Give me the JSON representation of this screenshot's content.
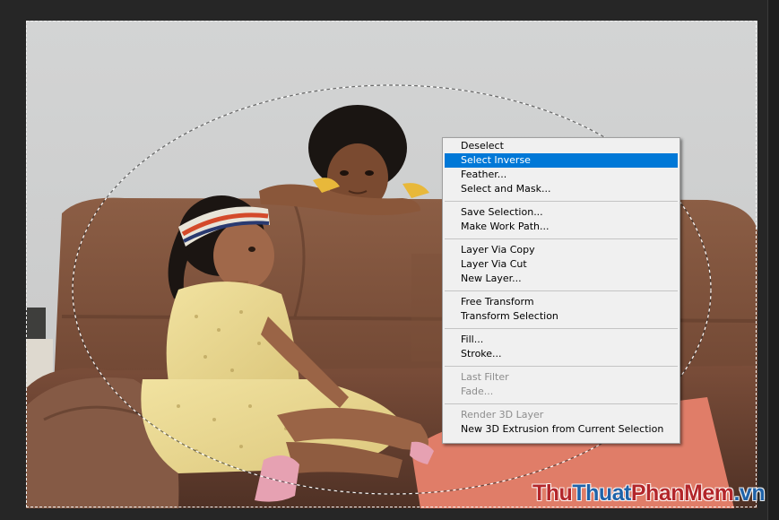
{
  "context_menu": {
    "groups": [
      [
        {
          "label": "Deselect",
          "enabled": true
        },
        {
          "label": "Select Inverse",
          "enabled": true,
          "highlighted": true
        },
        {
          "label": "Feather...",
          "enabled": true
        },
        {
          "label": "Select and Mask...",
          "enabled": true
        }
      ],
      [
        {
          "label": "Save Selection...",
          "enabled": true
        },
        {
          "label": "Make Work Path...",
          "enabled": true
        }
      ],
      [
        {
          "label": "Layer Via Copy",
          "enabled": true
        },
        {
          "label": "Layer Via Cut",
          "enabled": true
        },
        {
          "label": "New Layer...",
          "enabled": true
        }
      ],
      [
        {
          "label": "Free Transform",
          "enabled": true
        },
        {
          "label": "Transform Selection",
          "enabled": true
        }
      ],
      [
        {
          "label": "Fill...",
          "enabled": true
        },
        {
          "label": "Stroke...",
          "enabled": true
        }
      ],
      [
        {
          "label": "Last Filter",
          "enabled": false
        },
        {
          "label": "Fade...",
          "enabled": false
        }
      ],
      [
        {
          "label": "Render 3D Layer",
          "enabled": false
        },
        {
          "label": "New 3D Extrusion from Current Selection",
          "enabled": true
        }
      ]
    ]
  },
  "watermark": {
    "part1": "Thu",
    "part2": "Thuat",
    "part3": "PhanMem",
    "part4": ".vn"
  },
  "colors": {
    "highlight": "#0078d7",
    "workspace": "#262626",
    "menu_background": "#f0f0f0",
    "disabled_text": "#8d8d8d"
  }
}
